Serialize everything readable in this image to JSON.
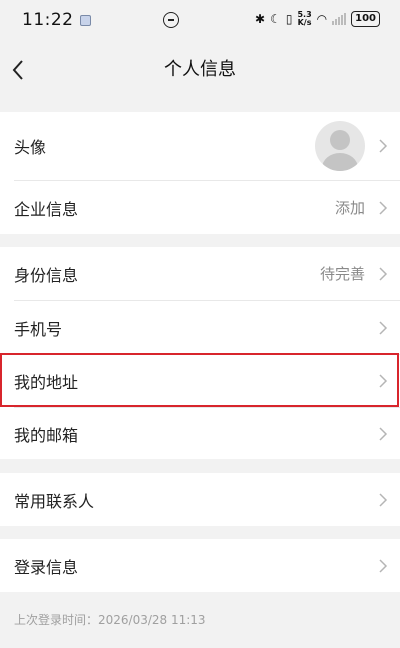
{
  "status_bar": {
    "time": "11:22",
    "net_speed_value": "5.3",
    "net_speed_unit": "K/s",
    "battery": "100"
  },
  "header": {
    "title": "个人信息"
  },
  "groups": [
    {
      "rows": [
        {
          "label": "头像",
          "value": ""
        },
        {
          "label": "企业信息",
          "value": "添加"
        }
      ]
    },
    {
      "rows": [
        {
          "label": "身份信息",
          "value": "待完善"
        },
        {
          "label": "手机号",
          "value": ""
        },
        {
          "label": "我的地址",
          "value": ""
        },
        {
          "label": "我的邮箱",
          "value": ""
        }
      ]
    },
    {
      "rows": [
        {
          "label": "常用联系人",
          "value": ""
        }
      ]
    },
    {
      "rows": [
        {
          "label": "登录信息",
          "value": ""
        }
      ]
    }
  ],
  "footer": {
    "last_login": "上次登录时间：2026/03/28  11:13"
  },
  "colors": {
    "background": "#f2f2f2",
    "highlight_border": "#d8252c",
    "secondary_text": "#8a8a8a"
  }
}
